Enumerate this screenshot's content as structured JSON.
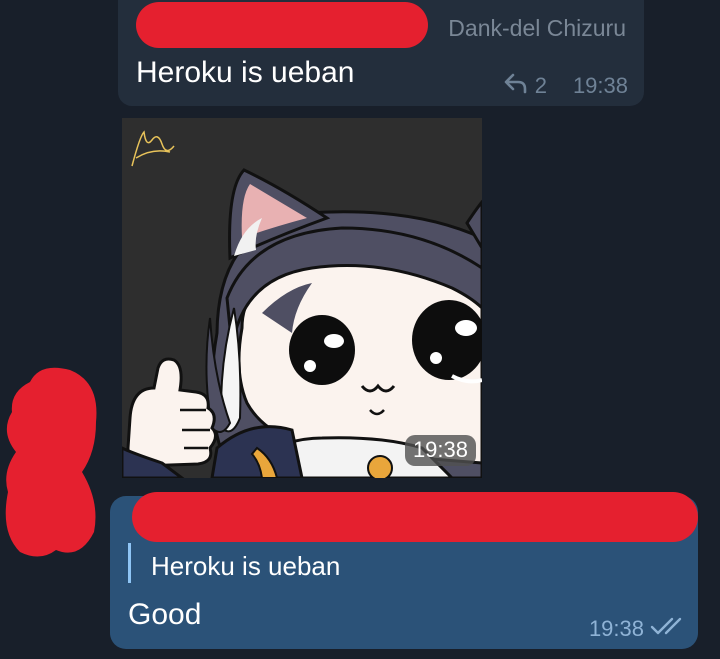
{
  "incoming_message": {
    "sender": "Dank-del Chizuru",
    "text": "Heroku is ueban",
    "reply_count": "2",
    "time": "19:38"
  },
  "sticker": {
    "time": "19:38"
  },
  "outgoing_message": {
    "quoted_text": "Heroku is ueban",
    "text": "Good",
    "time": "19:38",
    "status": "read"
  },
  "colors": {
    "background": "#181f2a",
    "incoming_bubble": "#232e3c",
    "outgoing_bubble": "#2b5278",
    "redaction": "#e5202f",
    "quote_bar": "#8fc5f5"
  },
  "icons": {
    "reply": "reply-arrow-icon",
    "read_status": "double-check-icon"
  }
}
